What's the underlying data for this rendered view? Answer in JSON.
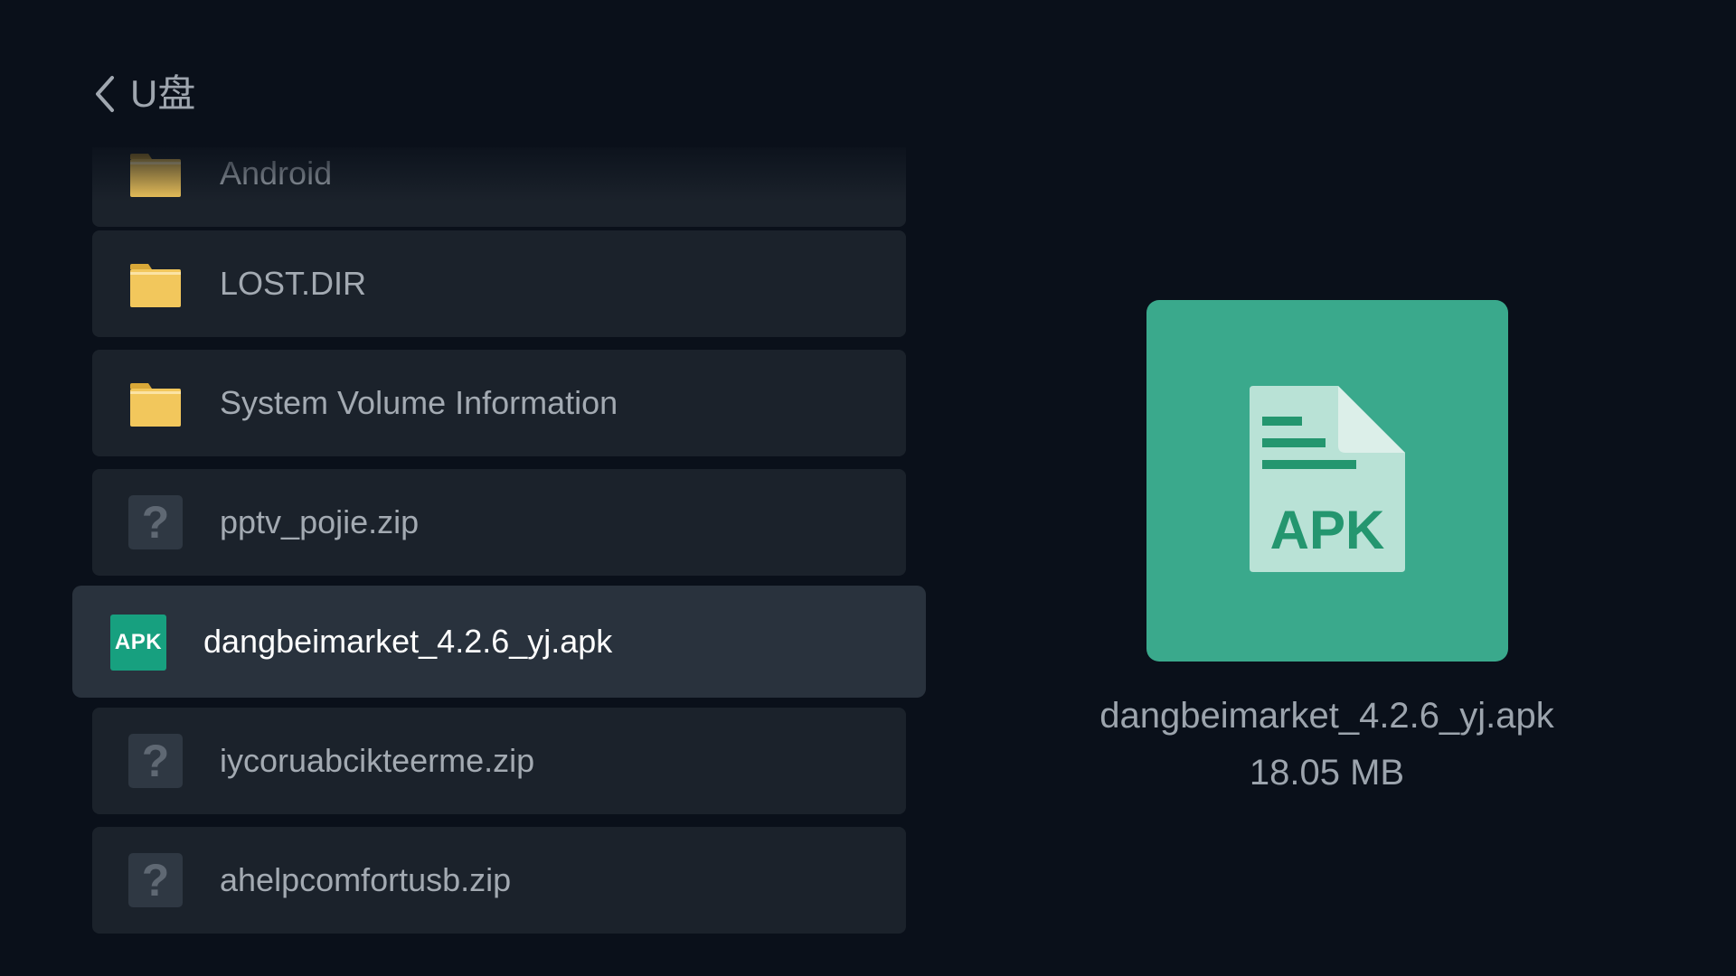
{
  "header": {
    "back_icon": "chevron-left-icon",
    "title": "U盘"
  },
  "file_list": {
    "items": [
      {
        "name": "Android",
        "type": "folder",
        "icon": "folder-icon"
      },
      {
        "name": "LOST.DIR",
        "type": "folder",
        "icon": "folder-icon"
      },
      {
        "name": "System Volume Information",
        "type": "folder",
        "icon": "folder-icon"
      },
      {
        "name": "pptv_pojie.zip",
        "type": "unknown",
        "icon": "unknown-file-icon",
        "icon_glyph": "?"
      },
      {
        "name": "dangbeimarket_4.2.6_yj.apk",
        "type": "apk",
        "icon": "apk-file-icon",
        "icon_text": "APK",
        "selected": true
      },
      {
        "name": "iycoruabcikteerme.zip",
        "type": "unknown",
        "icon": "unknown-file-icon",
        "icon_glyph": "?"
      },
      {
        "name": "ahelpcomfortusb.zip",
        "type": "unknown",
        "icon": "unknown-file-icon",
        "icon_glyph": "?"
      }
    ]
  },
  "preview": {
    "icon": "apk-document-icon",
    "icon_text": "APK",
    "file_name": "dangbeimarket_4.2.6_yj.apk",
    "file_size": "18.05 MB"
  },
  "colors": {
    "background": "#0a101a",
    "row": "#1b222b",
    "row_selected": "#29323d",
    "apk_green": "#3aa98c",
    "folder_yellow": "#f2c75c"
  }
}
